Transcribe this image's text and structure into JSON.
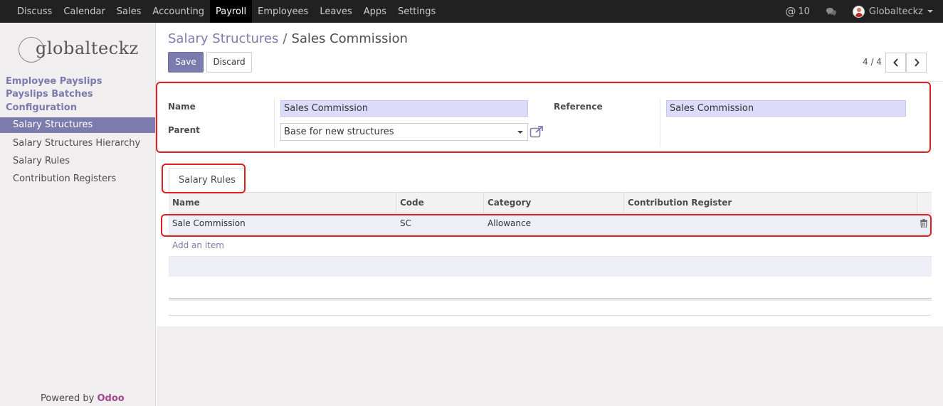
{
  "topbar": {
    "menu": [
      "Discuss",
      "Calendar",
      "Sales",
      "Accounting",
      "Payroll",
      "Employees",
      "Leaves",
      "Apps",
      "Settings"
    ],
    "active_menu": "Payroll",
    "mentions_count": "10",
    "user_name": "Globalteckz"
  },
  "sidebar": {
    "logo_text": "globalteckz",
    "sections": [
      "Employee Payslips",
      "Payslips Batches",
      "Configuration"
    ],
    "items": [
      "Salary Structures",
      "Salary Structures Hierarchy",
      "Salary Rules",
      "Contribution Registers"
    ],
    "active_item": "Salary Structures",
    "powered_prefix": "Powered by",
    "powered_brand": "Odoo"
  },
  "breadcrumb": {
    "parent": "Salary Structures",
    "separator": "/",
    "current": "Sales Commission"
  },
  "buttons": {
    "save": "Save",
    "discard": "Discard"
  },
  "pager": {
    "value": "4 / 4"
  },
  "form": {
    "name_label": "Name",
    "name_value": "Sales Commission",
    "parent_label": "Parent",
    "parent_value": "Base for new structures",
    "reference_label": "Reference",
    "reference_value": "Sales Commission"
  },
  "tabs": {
    "salary_rules": "Salary Rules"
  },
  "table": {
    "columns": [
      "Name",
      "Code",
      "Category",
      "Contribution Register"
    ],
    "rows": [
      {
        "name": "Sale Commission",
        "code": "SC",
        "category": "Allowance",
        "register": ""
      }
    ],
    "add_item": "Add an item"
  },
  "colors": {
    "accent": "#7c7bad",
    "topbar": "#212121",
    "highlight_border": "#e02020",
    "brand": "#a24689"
  },
  "icons": [
    "chat-icon",
    "at-icon",
    "external-link-icon",
    "trash-icon",
    "chevron-left-icon",
    "chevron-right-icon"
  ]
}
